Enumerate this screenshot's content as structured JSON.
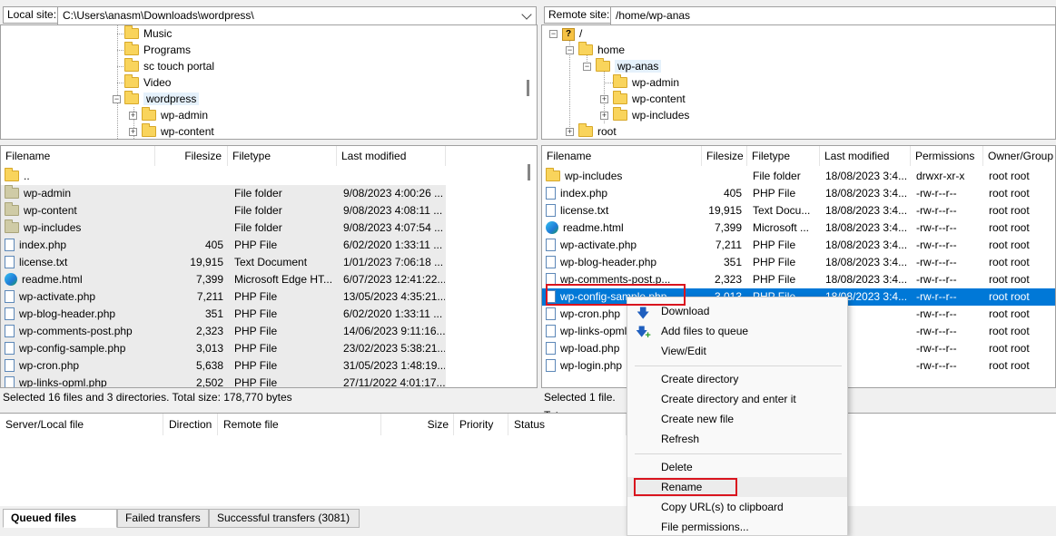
{
  "local_site": {
    "label": "Local site:",
    "path": "C:\\Users\\anasm\\Downloads\\wordpress\\"
  },
  "remote_site": {
    "label": "Remote site:",
    "path": "/home/wp-anas"
  },
  "local_tree": [
    "Music",
    "Programs",
    "sc touch portal",
    "Video",
    "wordpress",
    "wp-admin",
    "wp-content"
  ],
  "remote_tree": [
    "/",
    "home",
    "wp-anas",
    "wp-admin",
    "wp-content",
    "wp-includes",
    "root"
  ],
  "local_list": {
    "headers": [
      "Filename",
      "Filesize",
      "Filetype",
      "Last modified"
    ],
    "rows": [
      {
        "name": "..",
        "size": "",
        "type": "",
        "modified": "",
        "icon": "folder-icon"
      },
      {
        "name": "wp-admin",
        "size": "",
        "type": "File folder",
        "modified": "9/08/2023 4:00:26 ...",
        "icon": "folder-icon"
      },
      {
        "name": "wp-content",
        "size": "",
        "type": "File folder",
        "modified": "9/08/2023 4:08:11 ...",
        "icon": "folder-icon"
      },
      {
        "name": "wp-includes",
        "size": "",
        "type": "File folder",
        "modified": "9/08/2023 4:07:54 ...",
        "icon": "folder-icon"
      },
      {
        "name": "index.php",
        "size": "405",
        "type": "PHP File",
        "modified": "6/02/2020 1:33:11 ...",
        "icon": "file-icon"
      },
      {
        "name": "license.txt",
        "size": "19,915",
        "type": "Text Document",
        "modified": "1/01/2023 7:06:18 ...",
        "icon": "file-icon"
      },
      {
        "name": "readme.html",
        "size": "7,399",
        "type": "Microsoft Edge HT...",
        "modified": "6/07/2023 12:41:22...",
        "icon": "edge-icon"
      },
      {
        "name": "wp-activate.php",
        "size": "7,211",
        "type": "PHP File",
        "modified": "13/05/2023 4:35:21...",
        "icon": "file-icon"
      },
      {
        "name": "wp-blog-header.php",
        "size": "351",
        "type": "PHP File",
        "modified": "6/02/2020 1:33:11 ...",
        "icon": "file-icon"
      },
      {
        "name": "wp-comments-post.php",
        "size": "2,323",
        "type": "PHP File",
        "modified": "14/06/2023 9:11:16...",
        "icon": "file-icon"
      },
      {
        "name": "wp-config-sample.php",
        "size": "3,013",
        "type": "PHP File",
        "modified": "23/02/2023 5:38:21...",
        "icon": "file-icon"
      },
      {
        "name": "wp-cron.php",
        "size": "5,638",
        "type": "PHP File",
        "modified": "31/05/2023 1:48:19...",
        "icon": "file-icon"
      },
      {
        "name": "wp-links-opml.php",
        "size": "2,502",
        "type": "PHP File",
        "modified": "27/11/2022 4:01:17...",
        "icon": "file-icon"
      }
    ],
    "status": "Selected 16 files and 3 directories. Total size: 178,770 bytes"
  },
  "remote_list": {
    "headers": [
      "Filename",
      "Filesize",
      "Filetype",
      "Last modified",
      "Permissions",
      "Owner/Group"
    ],
    "rows": [
      {
        "name": "wp-includes",
        "size": "",
        "type": "File folder",
        "modified": "18/08/2023 3:4...",
        "perm": "drwxr-xr-x",
        "owner": "root root",
        "icon": "folder-icon"
      },
      {
        "name": "index.php",
        "size": "405",
        "type": "PHP File",
        "modified": "18/08/2023 3:4...",
        "perm": "-rw-r--r--",
        "owner": "root root",
        "icon": "file-icon"
      },
      {
        "name": "license.txt",
        "size": "19,915",
        "type": "Text Docu...",
        "modified": "18/08/2023 3:4...",
        "perm": "-rw-r--r--",
        "owner": "root root",
        "icon": "file-icon"
      },
      {
        "name": "readme.html",
        "size": "7,399",
        "type": "Microsoft ...",
        "modified": "18/08/2023 3:4...",
        "perm": "-rw-r--r--",
        "owner": "root root",
        "icon": "edge-icon"
      },
      {
        "name": "wp-activate.php",
        "size": "7,211",
        "type": "PHP File",
        "modified": "18/08/2023 3:4...",
        "perm": "-rw-r--r--",
        "owner": "root root",
        "icon": "file-icon"
      },
      {
        "name": "wp-blog-header.php",
        "size": "351",
        "type": "PHP File",
        "modified": "18/08/2023 3:4...",
        "perm": "-rw-r--r--",
        "owner": "root root",
        "icon": "file-icon"
      },
      {
        "name": "wp-comments-post.p...",
        "size": "2,323",
        "type": "PHP File",
        "modified": "18/08/2023 3:4...",
        "perm": "-rw-r--r--",
        "owner": "root root",
        "icon": "file-icon"
      },
      {
        "name": "wp-config-sample.php",
        "size": "3,013",
        "type": "PHP File",
        "modified": "18/08/2023 3:4...",
        "perm": "-rw-r--r--",
        "owner": "root root",
        "icon": "file-icon",
        "selected": true
      },
      {
        "name": "wp-cron.php",
        "size": "",
        "type": "",
        "modified": "...",
        "perm": "-rw-r--r--",
        "owner": "root root",
        "icon": "file-icon"
      },
      {
        "name": "wp-links-opml...",
        "size": "",
        "type": "",
        "modified": "...",
        "perm": "-rw-r--r--",
        "owner": "root root",
        "icon": "file-icon"
      },
      {
        "name": "wp-load.php",
        "size": "",
        "type": "",
        "modified": "...",
        "perm": "-rw-r--r--",
        "owner": "root root",
        "icon": "file-icon"
      },
      {
        "name": "wp-login.php",
        "size": "",
        "type": "",
        "modified": "...",
        "perm": "-rw-r--r--",
        "owner": "root root",
        "icon": "file-icon"
      }
    ],
    "status": "Selected 1 file. Tot"
  },
  "queue": {
    "headers": [
      "Server/Local file",
      "Direction",
      "Remote file",
      "Size",
      "Priority",
      "Status"
    ],
    "tabs": [
      "Queued files",
      "Failed transfers",
      "Successful transfers (3081)"
    ]
  },
  "context_menu": {
    "items": [
      {
        "label": "Download",
        "icon": "download-arrow-icon"
      },
      {
        "label": "Add files to queue",
        "icon": "add-queue-icon"
      },
      {
        "label": "View/Edit"
      },
      {
        "label": "Create directory"
      },
      {
        "label": "Create directory and enter it"
      },
      {
        "label": "Create new file"
      },
      {
        "label": "Refresh"
      },
      {
        "label": "Delete"
      },
      {
        "label": "Rename"
      },
      {
        "label": "Copy URL(s) to clipboard"
      },
      {
        "label": "File permissions..."
      }
    ]
  },
  "colors": {
    "selection": "#0078d7",
    "highlight_box": "#d9141e",
    "folder": "#f9d45c"
  }
}
